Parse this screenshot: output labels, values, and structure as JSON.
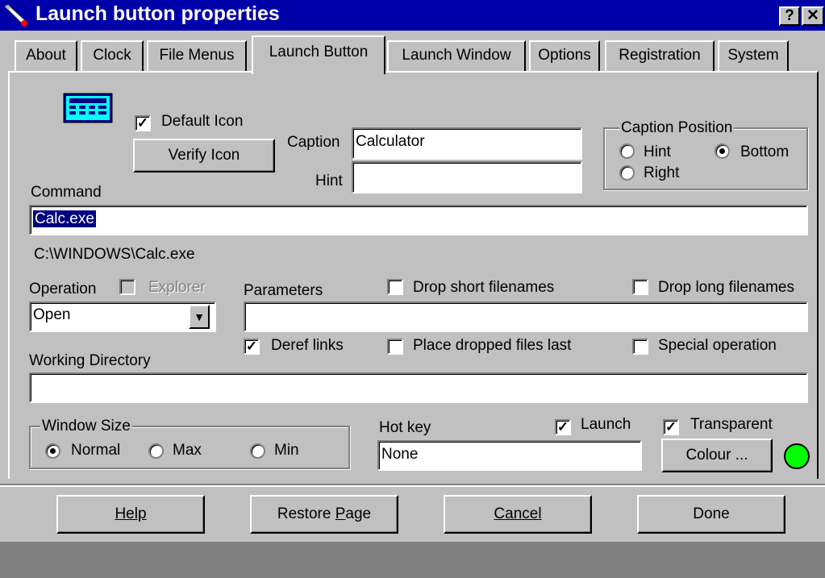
{
  "window": {
    "title": "Launch button properties",
    "help_glyph": "?",
    "close_glyph": "✕"
  },
  "tabs": [
    {
      "label": "About"
    },
    {
      "label": "Clock"
    },
    {
      "label": "File Menus"
    },
    {
      "label": "Launch Button",
      "active": true
    },
    {
      "label": "Launch Window"
    },
    {
      "label": "Options"
    },
    {
      "label": "Registration"
    },
    {
      "label": "System"
    }
  ],
  "icon": {
    "name": "calculator-icon"
  },
  "default_icon": {
    "label": "Default Icon",
    "checked": true
  },
  "verify_icon": {
    "label": "Verify Icon"
  },
  "caption": {
    "label": "Caption",
    "value": "Calculator"
  },
  "hint": {
    "label": "Hint",
    "value": ""
  },
  "caption_position": {
    "title": "Caption Position",
    "options": [
      "Hint",
      "Bottom",
      "Right"
    ],
    "selected": "Bottom"
  },
  "command": {
    "label": "Command",
    "value": "Calc.exe",
    "resolved_path": "C:\\WINDOWS\\Calc.exe"
  },
  "operation": {
    "label": "Operation",
    "value": "Open",
    "explorer_label": "Explorer",
    "explorer_enabled": false
  },
  "parameters": {
    "label": "Parameters",
    "value": ""
  },
  "checkboxes": {
    "drop_short": {
      "label": "Drop short filenames",
      "checked": false
    },
    "drop_long": {
      "label": "Drop long filenames",
      "checked": false
    },
    "deref_links": {
      "label": "Deref links",
      "checked": true
    },
    "place_dropped_last": {
      "label": "Place dropped files last",
      "checked": false
    },
    "special_operation": {
      "label": "Special operation",
      "checked": false
    }
  },
  "working_directory": {
    "label": "Working Directory",
    "value": ""
  },
  "window_size": {
    "title": "Window Size",
    "options": [
      "Normal",
      "Max",
      "Min"
    ],
    "selected": "Normal"
  },
  "hot_key": {
    "label": "Hot key",
    "value": "None"
  },
  "launch": {
    "label": "Launch",
    "checked": true
  },
  "transparent": {
    "label": "Transparent",
    "checked": true
  },
  "colour_button": {
    "label": "Colour ..."
  },
  "colour_indicator": {
    "color": "#00ff00"
  },
  "footer": {
    "help": "Help",
    "restore_page_prefix": "Restore ",
    "restore_page_mnemonic": "P",
    "restore_page_suffix": "age",
    "cancel": "Cancel",
    "done": "Done"
  },
  "check_glyph": "✓",
  "combo_arrow_glyph": "▼"
}
